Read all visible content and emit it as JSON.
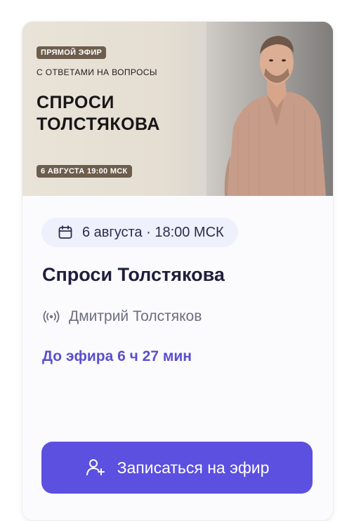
{
  "banner": {
    "live_label": "ПРЯМОЙ ЭФИР",
    "subtitle": "С ОТВЕТАМИ НА ВОПРОСЫ",
    "title_line1": "СПРОСИ",
    "title_line2": "ТОЛСТЯКОВА",
    "date_label": "6 АВГУСТА 19:00 МСК"
  },
  "event": {
    "date_chip": "6 августа · 18:00 МСК",
    "title": "Спроси Толстякова",
    "author": "Дмитрий Толстяков",
    "countdown": "До эфира 6 ч 27 мин"
  },
  "cta": {
    "label": "Записаться на эфир"
  },
  "icons": {
    "date": "calendar-icon",
    "author": "broadcast-icon",
    "cta": "add-user-icon"
  },
  "colors": {
    "accent": "#5b50df",
    "countdown": "#5a4fd0",
    "chip_bg": "#eef0fb",
    "banner_badge": "#6d5d4d"
  }
}
